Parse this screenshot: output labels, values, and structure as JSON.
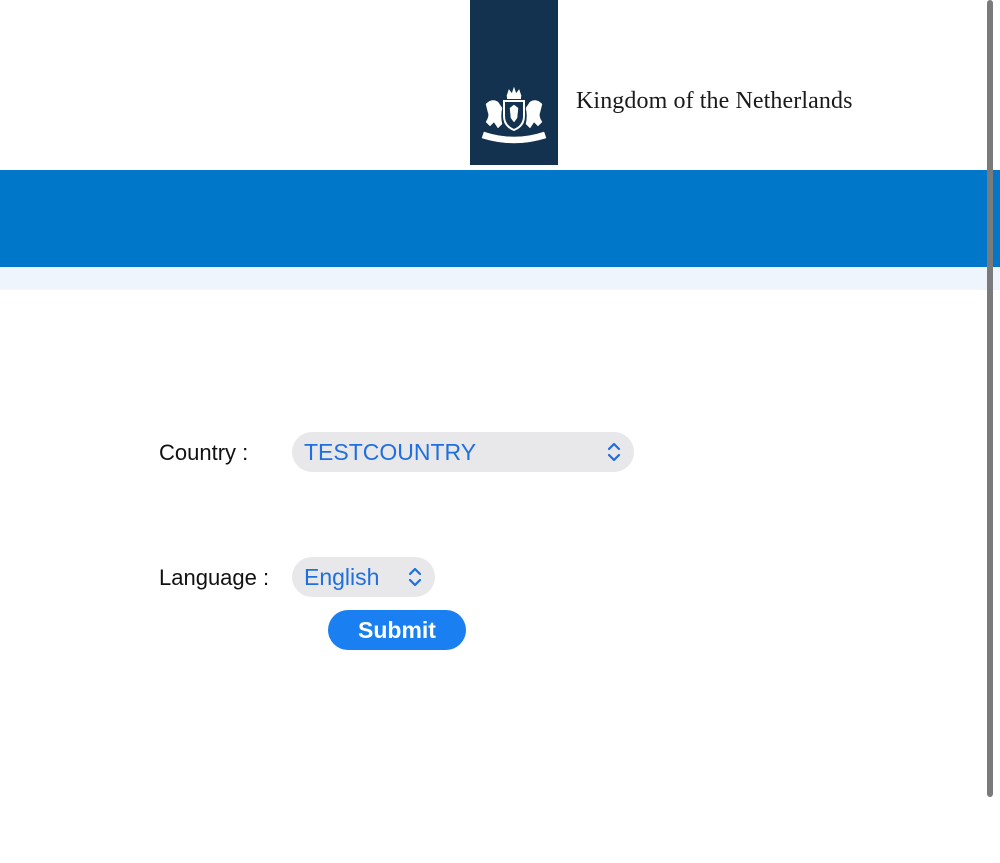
{
  "header": {
    "title": "Kingdom of the Netherlands",
    "logo_icon": "royal-coat-of-arms-icon",
    "logo_color": "#13324f",
    "band_color": "#0077c8"
  },
  "form": {
    "country_label": "Country :",
    "country_value": "TESTCOUNTRY",
    "language_label": "Language :",
    "language_value": "English",
    "submit_label": "Submit",
    "accent_color": "#1a7ff0"
  }
}
